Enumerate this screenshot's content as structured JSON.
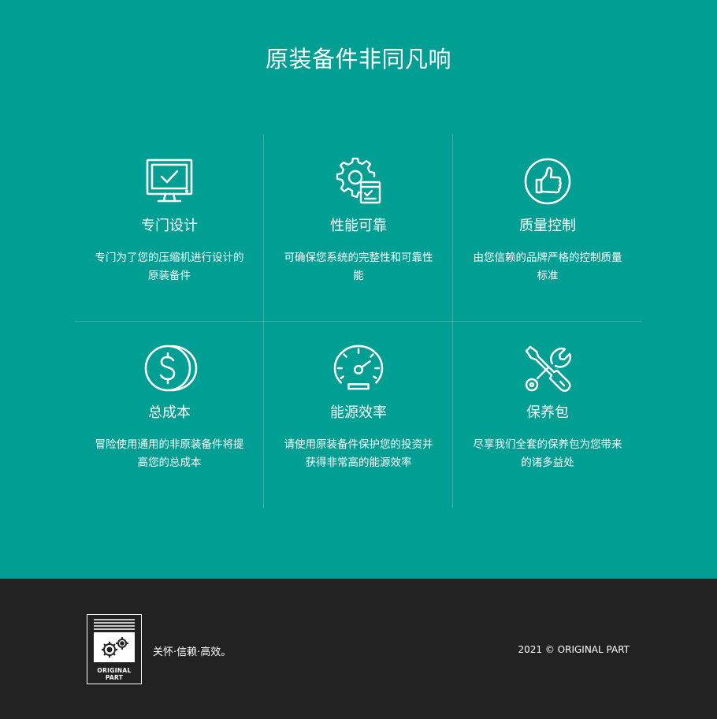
{
  "hero": {
    "title": "原装备件非同凡响"
  },
  "features": [
    {
      "icon": "monitor-check-icon",
      "title": "专门设计",
      "description": "专门为了您的压缩机进行设计的原装备件"
    },
    {
      "icon": "gear-checklist-icon",
      "title": "性能可靠",
      "description": "可确保您系统的完整性和可靠性能"
    },
    {
      "icon": "thumbs-up-icon",
      "title": "质量控制",
      "description": "由您信赖的品牌严格的控制质量标准"
    },
    {
      "icon": "dollar-coin-icon",
      "title": "总成本",
      "description": "冒险使用通用的非原装备件将提高您的总成本"
    },
    {
      "icon": "speedometer-icon",
      "title": "能源效率",
      "description": "请使用原装备件保护您的投资并获得非常高的能源效率"
    },
    {
      "icon": "wrench-screwdriver-icon",
      "title": "保养包",
      "description": "尽享我们全套的保养包为您带来的诸多益处"
    }
  ],
  "footer": {
    "logo_text": "ORIGINAL PART",
    "tagline": "关怀·信赖·高效。",
    "copyright": "2021 © ORIGINAL PART"
  },
  "colors": {
    "hero_background": "#009e93",
    "footer_background": "#222222",
    "text": "#ffffff"
  }
}
